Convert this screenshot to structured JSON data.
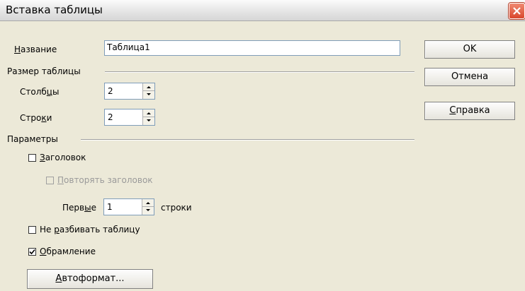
{
  "window": {
    "title": "Вставка таблицы"
  },
  "name_field": {
    "label_u": "Н",
    "label_rest": "азвание",
    "value": "Таблица1"
  },
  "size_group": {
    "title": "Размер таблицы",
    "columns": {
      "label_pre": "Столб",
      "label_u": "ц",
      "label_post": "ы",
      "value": "2"
    },
    "rows": {
      "label_pre": "Стро",
      "label_u": "к",
      "label_post": "и",
      "value": "2"
    }
  },
  "params_group": {
    "title": "Параметры",
    "heading": {
      "label_u": "З",
      "label_rest": "аголовок",
      "checked": false
    },
    "repeat_heading": {
      "label_u": "П",
      "label_rest": "овторять заголовок",
      "checked": false,
      "disabled": true
    },
    "first_rows": {
      "label_pre": "Перв",
      "label_u": "ы",
      "label_post": "е",
      "value": "1",
      "suffix": "строки"
    },
    "dont_split": {
      "label_pre": "Не ",
      "label_u": "р",
      "label_post": "азбивать таблицу",
      "checked": false
    },
    "border": {
      "label_u": "О",
      "label_rest": "брамление",
      "checked": true
    }
  },
  "buttons": {
    "ok": "OK",
    "cancel": "Отмена",
    "help_u": "С",
    "help_rest": "правка",
    "autoformat_u": "А",
    "autoformat_rest": "втоформат..."
  }
}
